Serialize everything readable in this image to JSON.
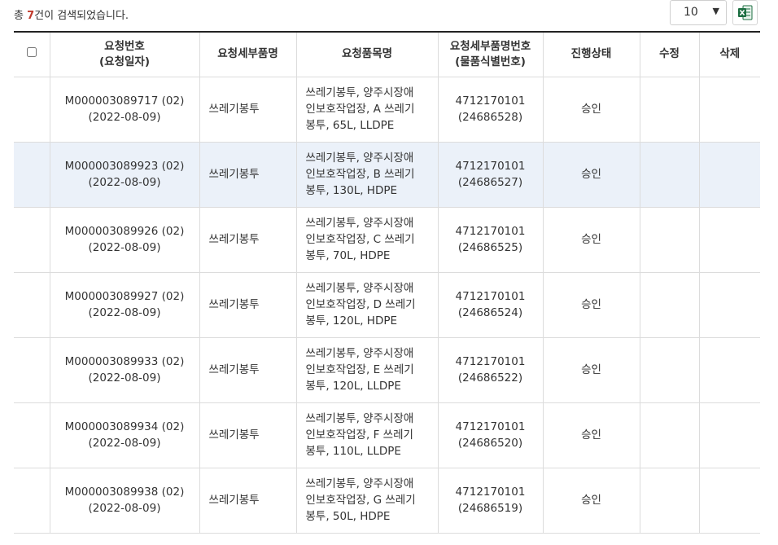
{
  "summary": {
    "prefix": "총 ",
    "count": "7",
    "suffix": "건이 검색되었습니다."
  },
  "page_size": {
    "value": "10"
  },
  "excel_button": {
    "icon": "excel-icon",
    "color": "#1d6f42"
  },
  "columns": {
    "request_no": "요청번호",
    "request_date": "(요청일자)",
    "detail_name": "요청세부품명",
    "item_name": "요청품목명",
    "detail_no": "요청세부품명번호",
    "item_id": "(물품식별번호)",
    "status": "진행상태",
    "edit": "수정",
    "delete": "삭제"
  },
  "rows": [
    {
      "req_no": "M000003089717 (02)",
      "req_date": "(2022-08-09)",
      "detail_name": "쓰레기봉투",
      "item_l1": "쓰레기봉투, 양주시장애",
      "item_l2": "인보호작업장, A 쓰레기",
      "item_l3": "봉투, 65L, LLDPE",
      "detail_no": "4712170101",
      "item_id": "(24686528)",
      "status": "승인"
    },
    {
      "req_no": "M000003089923 (02)",
      "req_date": "(2022-08-09)",
      "detail_name": "쓰레기봉투",
      "item_l1": "쓰레기봉투, 양주시장애",
      "item_l2": "인보호작업장, B 쓰레기",
      "item_l3": "봉투, 130L, HDPE",
      "detail_no": "4712170101",
      "item_id": "(24686527)",
      "status": "승인"
    },
    {
      "req_no": "M000003089926 (02)",
      "req_date": "(2022-08-09)",
      "detail_name": "쓰레기봉투",
      "item_l1": "쓰레기봉투, 양주시장애",
      "item_l2": "인보호작업장, C 쓰레기",
      "item_l3": "봉투, 70L, HDPE",
      "detail_no": "4712170101",
      "item_id": "(24686525)",
      "status": "승인"
    },
    {
      "req_no": "M000003089927 (02)",
      "req_date": "(2022-08-09)",
      "detail_name": "쓰레기봉투",
      "item_l1": "쓰레기봉투, 양주시장애",
      "item_l2": "인보호작업장, D 쓰레기",
      "item_l3": "봉투, 120L, HDPE",
      "detail_no": "4712170101",
      "item_id": "(24686524)",
      "status": "승인"
    },
    {
      "req_no": "M000003089933 (02)",
      "req_date": "(2022-08-09)",
      "detail_name": "쓰레기봉투",
      "item_l1": "쓰레기봉투, 양주시장애",
      "item_l2": "인보호작업장, E 쓰레기",
      "item_l3": "봉투, 120L, LLDPE",
      "detail_no": "4712170101",
      "item_id": "(24686522)",
      "status": "승인"
    },
    {
      "req_no": "M000003089934 (02)",
      "req_date": "(2022-08-09)",
      "detail_name": "쓰레기봉투",
      "item_l1": "쓰레기봉투, 양주시장애",
      "item_l2": "인보호작업장, F 쓰레기",
      "item_l3": "봉투, 110L, LLDPE",
      "detail_no": "4712170101",
      "item_id": "(24686520)",
      "status": "승인"
    },
    {
      "req_no": "M000003089938 (02)",
      "req_date": "(2022-08-09)",
      "detail_name": "쓰레기봉투",
      "item_l1": "쓰레기봉투, 양주시장애",
      "item_l2": "인보호작업장, G 쓰레기",
      "item_l3": "봉투, 50L, HDPE",
      "detail_no": "4712170101",
      "item_id": "(24686519)",
      "status": "승인"
    }
  ],
  "colors": {
    "header_border": "#222222",
    "selected_row": "#ebf1f9",
    "link": "#3e5c91",
    "count": "#c0392b"
  }
}
